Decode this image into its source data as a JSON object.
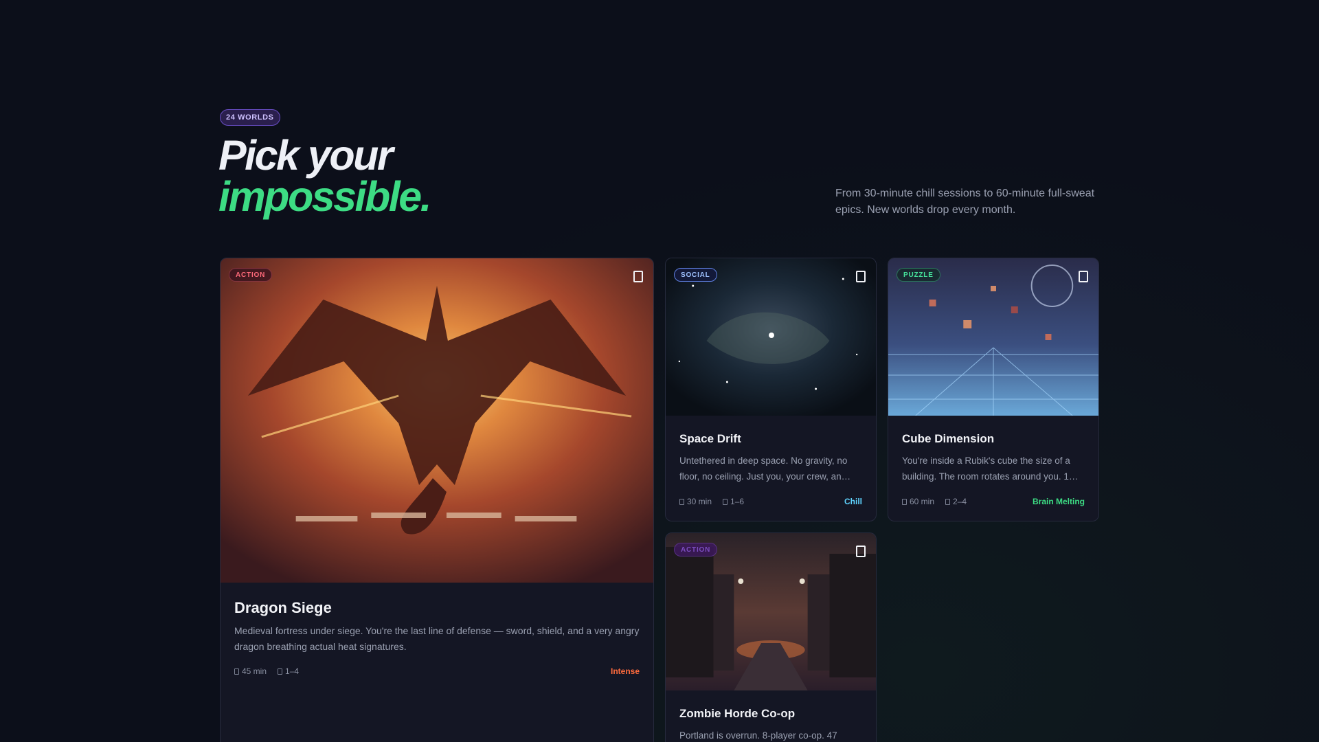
{
  "header": {
    "count_badge": "24 WORLDS",
    "headline_line1": "Pick your",
    "headline_line2": "impossible.",
    "subcopy": "From 30-minute chill sessions to 60-minute full-sweat epics. New worlds drop every month."
  },
  "colors": {
    "accent_green": "#3ddc84",
    "accent_purple": "#6b4fc9",
    "intense": "#ff6b3d",
    "chill": "#5fd4ff",
    "background": "#0c0f1a"
  },
  "cards": [
    {
      "category": "ACTION",
      "title": "Dragon Siege",
      "description": "Medieval fortress under siege. You're the last line of defense — sword, shield, and a very angry dragon breathing actual heat signatures.",
      "duration": "45 min",
      "players": "1–4",
      "intensity": "Intense",
      "icon": "bookmark-icon"
    },
    {
      "category": "SOCIAL",
      "title": "Space Drift",
      "description": "Untethered in deep space. No gravity, no floor, no ceiling. Just you, your crew, an…",
      "duration": "30 min",
      "players": "1–6",
      "intensity": "Chill",
      "icon": "bookmark-icon"
    },
    {
      "category": "PUZZLE",
      "title": "Cube Dimension",
      "description": "You're inside a Rubik's cube the size of a building. The room rotates around you. 1…",
      "duration": "60 min",
      "players": "2–4",
      "intensity": "Brain Melting",
      "icon": "bookmark-icon"
    },
    {
      "category": "ACTION",
      "title": "Zombie Horde Co-op",
      "description": "Portland is overrun. 8-player co-op. 47",
      "icon": "bookmark-icon"
    }
  ]
}
